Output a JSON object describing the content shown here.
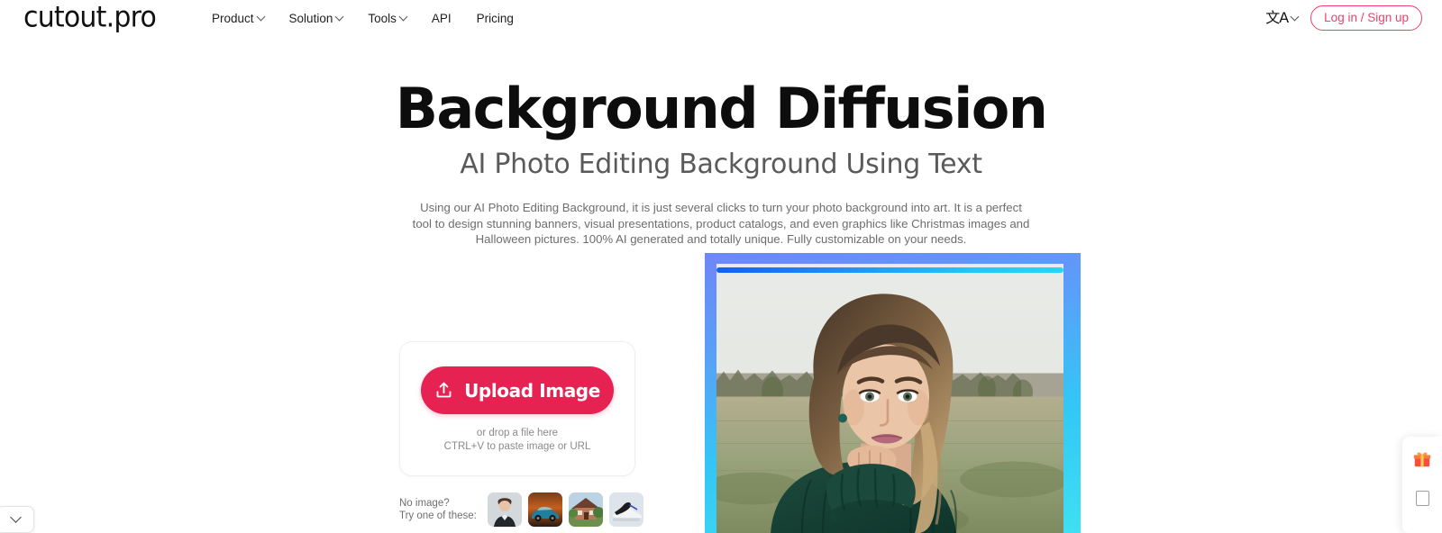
{
  "header": {
    "logo": "cutout.pro",
    "nav": [
      {
        "label": "Product",
        "has_caret": true
      },
      {
        "label": "Solution",
        "has_caret": true
      },
      {
        "label": "Tools",
        "has_caret": true
      },
      {
        "label": "API",
        "has_caret": false
      },
      {
        "label": "Pricing",
        "has_caret": false
      }
    ],
    "language_glyph": "文A",
    "login_label": "Log in / Sign up",
    "accent_color": "#ef3f6c"
  },
  "hero": {
    "title": "Background Diffusion",
    "subtitle": "AI Photo Editing Background Using Text",
    "description": "Using our AI Photo Editing Background, it is just several clicks to turn your photo background into art. It is a perfect tool to design stunning banners, visual presentations, product catalogs, and even graphics like Christmas images and Halloween pictures. 100% AI generated and totally unique. Fully customizable on your needs."
  },
  "upload": {
    "button_label": "Upload Image",
    "button_color": "#e62253",
    "drop_line_1": "or drop a file here",
    "drop_line_2": "CTRL+V to paste image or URL"
  },
  "samples": {
    "label_line_1": "No image?",
    "label_line_2": "Try one of these:",
    "thumbnails": [
      {
        "name": "sample-portrait",
        "alt": "woman portrait on light gray background"
      },
      {
        "name": "sample-car",
        "alt": "blue sports car on dark orange background"
      },
      {
        "name": "sample-house",
        "alt": "brick house with trees"
      },
      {
        "name": "sample-sneaker",
        "alt": "black and white high-top sneaker"
      }
    ]
  },
  "preview": {
    "alt": "Woman in dark green knit sweater standing in an open field with forest treeline and overcast sky",
    "frame_gradient_start": "#6f86f7",
    "frame_gradient_end": "#3ee0f2",
    "scanline_color": "#1160f5"
  },
  "widget": {
    "gift_icon": "gift-icon",
    "panel_icon": "panel-icon"
  },
  "bottom_left": {
    "icon": "chevron-down-icon"
  }
}
